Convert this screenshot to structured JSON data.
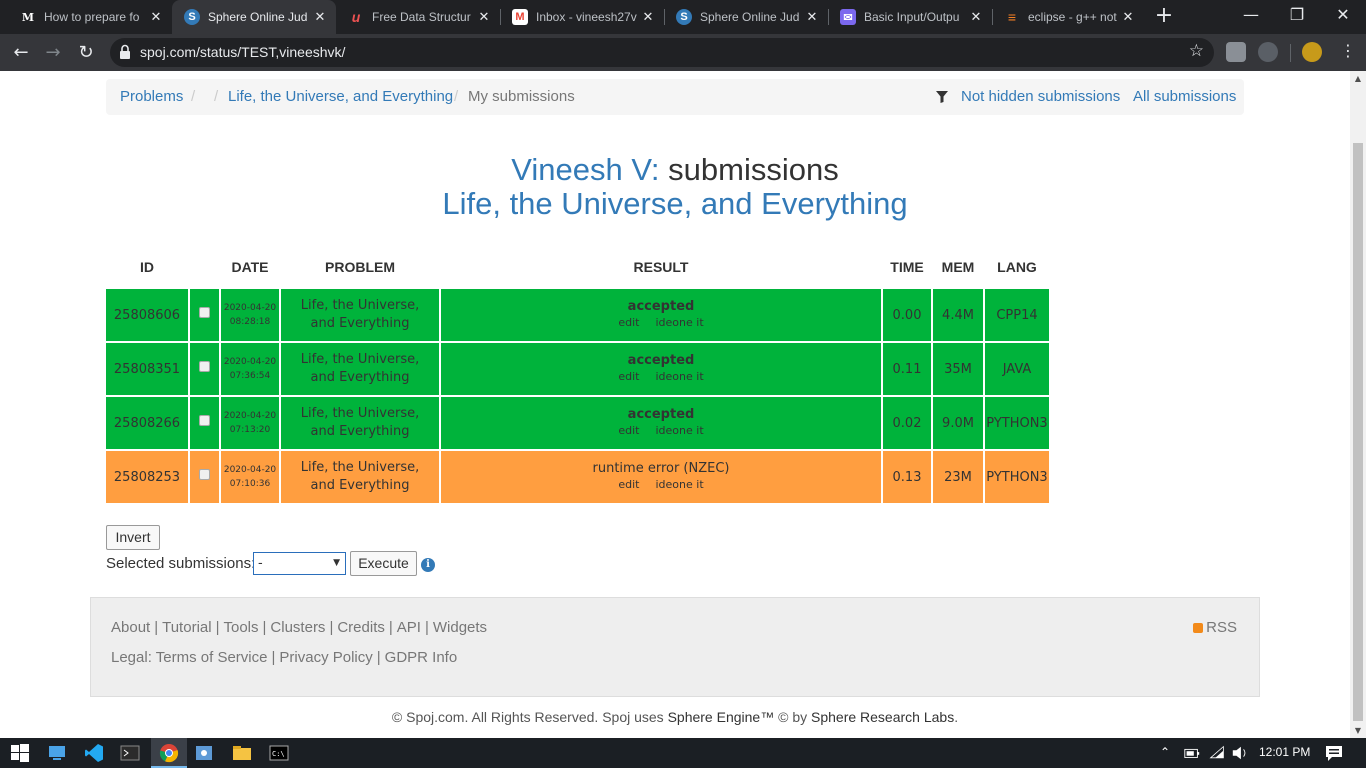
{
  "browser": {
    "tabs": [
      {
        "title": "How to prepare fo",
        "favicon": "M",
        "favicon_color": "#ffffff",
        "active": false
      },
      {
        "title": "Sphere Online Jud",
        "favicon": "S",
        "favicon_color": "#337ab7",
        "active": true
      },
      {
        "title": "Free Data Structur",
        "favicon": "u",
        "favicon_color": "#ec5252",
        "active": false
      },
      {
        "title": "Inbox - vineesh27v",
        "favicon": "M",
        "favicon_color": "#ea4335",
        "active": false
      },
      {
        "title": "Sphere Online Jud",
        "favicon": "S",
        "favicon_color": "#337ab7",
        "active": false
      },
      {
        "title": "Basic Input/Outpu",
        "favicon": "✉",
        "favicon_color": "#7b68ee",
        "active": false
      },
      {
        "title": "eclipse - g++ not",
        "favicon": "≡",
        "favicon_color": "#f48024",
        "active": false
      }
    ],
    "close_glyph": "✕",
    "new_tab_glyph": "+",
    "url": "spoj.com/status/TEST,vineeshvk/"
  },
  "breadcrumb": {
    "problems": "Problems",
    "sep1": "/",
    "sep2": "/",
    "problem": "Life, the Universe, and Everything",
    "sep3": "/",
    "current": "My submissions",
    "not_hidden": "Not hidden submissions",
    "all": "All submissions"
  },
  "heading": {
    "user": "Vineesh V:",
    "suffix": "submissions",
    "problem": "Life, the Universe, and Everything"
  },
  "table": {
    "headers": {
      "id": "ID",
      "date": "DATE",
      "problem": "PROBLEM",
      "result": "RESULT",
      "time": "TIME",
      "mem": "MEM",
      "lang": "LANG"
    },
    "rows": [
      {
        "id": "25808606",
        "date": "2020-04-20",
        "clock": "08:28:18",
        "problem_line1": "Life, the Universe,",
        "problem_line2": "and Everything",
        "result": "accepted",
        "edit": "edit",
        "ideone": "ideone it",
        "time": "0.00",
        "mem": "4.4M",
        "lang": "CPP14",
        "status_color": "#00b33b"
      },
      {
        "id": "25808351",
        "date": "2020-04-20",
        "clock": "07:36:54",
        "problem_line1": "Life, the Universe,",
        "problem_line2": "and Everything",
        "result": "accepted",
        "edit": "edit",
        "ideone": "ideone it",
        "time": "0.11",
        "mem": "35M",
        "lang": "JAVA",
        "status_color": "#00b33b"
      },
      {
        "id": "25808266",
        "date": "2020-04-20",
        "clock": "07:13:20",
        "problem_line1": "Life, the Universe,",
        "problem_line2": "and Everything",
        "result": "accepted",
        "edit": "edit",
        "ideone": "ideone it",
        "time": "0.02",
        "mem": "9.0M",
        "lang": "PYTHON3",
        "status_color": "#00b33b"
      },
      {
        "id": "25808253",
        "date": "2020-04-20",
        "clock": "07:10:36",
        "problem_line1": "Life, the Universe,",
        "problem_line2": "and Everything",
        "result": "runtime error (NZEC)",
        "edit": "edit",
        "ideone": "ideone it",
        "time": "0.13",
        "mem": "23M",
        "lang": "PYTHON3",
        "status_color": "#ff9e40"
      }
    ]
  },
  "actions": {
    "invert": "Invert",
    "selected_label": "Selected submissions:",
    "select_value": "-",
    "execute": "Execute",
    "info_glyph": "i"
  },
  "footer": {
    "links": [
      "About",
      "Tutorial",
      "Tools",
      "Clusters",
      "Credits",
      "API",
      "Widgets"
    ],
    "separator": "|",
    "legal_label": "Legal:",
    "legal_links": [
      "Terms of Service",
      "Privacy Policy",
      "GDPR Info"
    ],
    "rss": "RSS",
    "copyright_prefix": "© Spoj.com. All Rights Reserved. Spoj uses ",
    "sphere_engine": "Sphere Engine™",
    "copyright_mid": " © by ",
    "sphere_labs": "Sphere Research Labs",
    "copyright_end": "."
  },
  "taskbar": {
    "time": "12:01 PM"
  },
  "colors": {
    "accepted": "#00b33b",
    "runtime_error": "#ff9e40",
    "link": "#337ab7"
  }
}
